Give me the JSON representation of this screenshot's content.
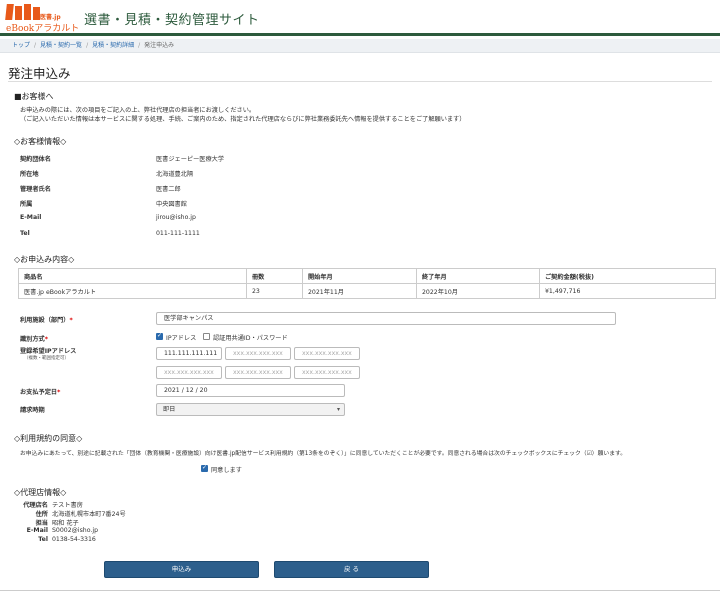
{
  "header": {
    "logo_ishojp": "医書.jp",
    "logo_text": "eBookアラカルト",
    "site_title": "選書・見積・契約管理サイト",
    "brand_color": "#2c5a3c",
    "logo_color": "#e8591a"
  },
  "breadcrumb": [
    "トップ",
    "見積・契約一覧",
    "見積・契約詳細",
    "発注申込み"
  ],
  "page_title": "発注申込み",
  "notice": {
    "heading": "■お客様へ",
    "line1": "お申込みの際には、次の項目をご記入の上、弊社代理店の担当者にお渡しください。",
    "line2": "（ご記入いただいた情報は本サービスに関する処理、手続、ご案内のため、指定された代理店ならびに弊社業務委託先へ情報を提供することをご了解願います）"
  },
  "customer": {
    "heading": "◇お客様情報◇",
    "rows": [
      {
        "label": "契約団体名",
        "value": "医書ジェーピー医療大学"
      },
      {
        "label": "所在地",
        "value": "北海道豊北隔"
      },
      {
        "label": "管理者氏名",
        "value": "医書二郎"
      },
      {
        "label": "所属",
        "value": "中央図書館"
      },
      {
        "label": "E-Mail",
        "value": "jirou@isho.jp"
      },
      {
        "label": "Tel",
        "value": "011-111-1111"
      }
    ]
  },
  "order": {
    "heading": "◇お申込み内容◇",
    "columns": [
      "商品名",
      "冊数",
      "開始年月",
      "終了年月",
      "ご契約金額(税抜)"
    ],
    "row": [
      "医書.jp eBookアラカルト",
      "23",
      "2021年11月",
      "2022年10月",
      "¥1,497,716"
    ]
  },
  "form": {
    "facility_label": "利用施設（部門）",
    "facility_value": "医学部キャンパス",
    "auth_label": "識別方式",
    "auth_ip": "IPアドレス",
    "auth_id": "認証用共通ID・パスワード",
    "ip_label": "登録希望IPアドレス",
    "ip_sublabel": "（複数・範囲指定可）",
    "ip_first": "111.111.111.111",
    "ip_placeholder": "xxx.xxx.xxx.xxx",
    "pay_label": "お支払予定日",
    "pay_value": "2021 / 12 / 20",
    "billing_label": "請求時期",
    "billing_value": "即日",
    "required_mark": "*"
  },
  "terms": {
    "heading": "◇利用規約の同意◇",
    "text": "お申込みにあたって、別途に記載された「団体（教育機関・医療施設）向け医書.jp配信サービス利用規約（第13条をのぞく）」に同意していただくことが必要です。同意される場合は次のチェックボックスにチェック（☑）願います。",
    "agree": "同意します"
  },
  "agent": {
    "heading": "◇代理店情報◇",
    "rows": [
      {
        "label": "代理店名",
        "value": "テスト書房"
      },
      {
        "label": "住所",
        "value": "北海道札幌市本町7番24号"
      },
      {
        "label": "担当",
        "value": "昭和 花子"
      },
      {
        "label": "E-Mail",
        "value": "S0002@isho.jp"
      },
      {
        "label": "Tel",
        "value": "0138-54-3316"
      }
    ]
  },
  "buttons": {
    "submit": "申込み",
    "back": "戻 る"
  }
}
